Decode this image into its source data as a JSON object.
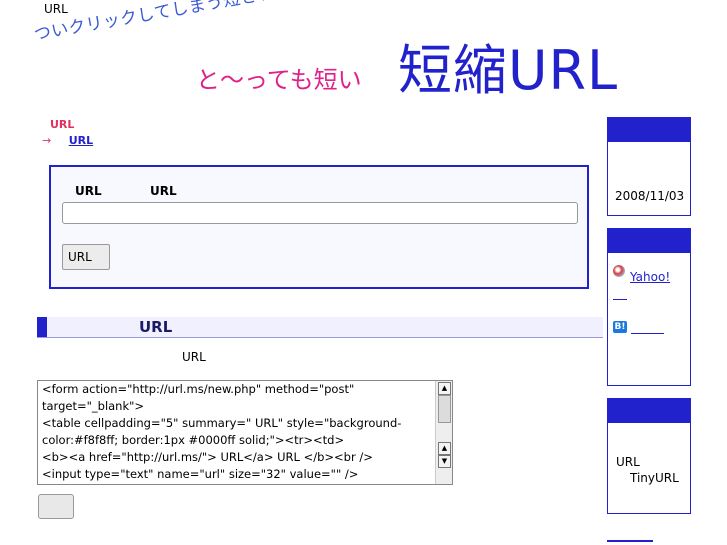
{
  "header": {
    "top_text": "URL",
    "slogan": "ついクリックしてしまう短さ、高圧縮率！",
    "subtitle": "と〜っても短い",
    "logo": "短縮URL"
  },
  "breadcrumb": {
    "home": "URL",
    "arrow": "→",
    "current": "URL"
  },
  "form": {
    "label_1": "URL",
    "label_2": "URL",
    "input_value": "",
    "submit_label": "URL"
  },
  "section": {
    "title": "URL",
    "description": "URL"
  },
  "code_lines": [
    "<form action=\"http://url.ms/new.php\" method=\"post\"",
    "target=\"_blank\">",
    "<table cellpadding=\"5\" summary=\"  URL\" style=\"background-",
    "color:#f8f8ff; border:1px #0000ff solid;\"><tr><td>",
    "<b><a href=\"http://url.ms/\">  URL</a>        URL </b><br />",
    "<input type=\"text\" name=\"url\" size=\"32\" value=\"\" />"
  ],
  "copy_button_label": "",
  "sidebar": {
    "box1_date": "2008/11/03",
    "yahoo_label": "Yahoo!",
    "hatena_icon_text": "B!",
    "box3_line1": "URL",
    "box3_line2": "TinyURL"
  },
  "colors": {
    "accent_blue": "#2222cc",
    "pink": "#e0218a",
    "panel_bg": "#f8f8ff"
  }
}
